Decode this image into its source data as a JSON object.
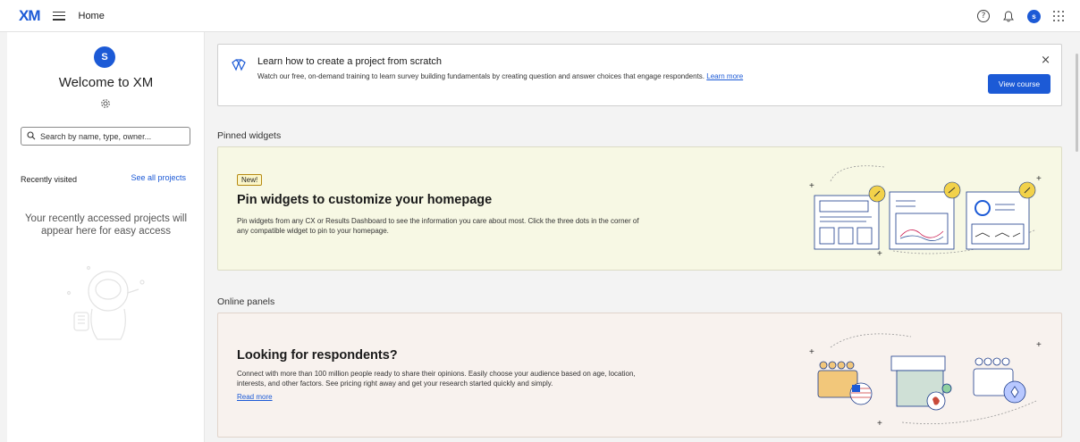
{
  "topbar": {
    "logo": "XM",
    "title": "Home",
    "help_icon": "?",
    "avatar_initial": "s"
  },
  "sidebar": {
    "avatar_initial": "S",
    "welcome": "Welcome to XM",
    "search_placeholder": "Search by name, type, owner...",
    "recently_visited": "Recently visited",
    "see_all": "See all projects",
    "empty_message": "Your recently accessed projects will appear here for easy access"
  },
  "learn": {
    "title": "Learn how to create a project from scratch",
    "description": "Watch our free, on-demand training to learn survey building fundamentals by creating question and answer choices that engage respondents.",
    "link": "Learn more",
    "close": "×",
    "button": "View course"
  },
  "pinned": {
    "section_title": "Pinned widgets",
    "badge": "New!",
    "title": "Pin widgets to customize your homepage",
    "description": "Pin widgets from any CX or Results Dashboard to see the information you care about most. Click the three dots in the corner of any compatible widget to pin to your homepage."
  },
  "online": {
    "section_title": "Online panels",
    "title": "Looking for respondents?",
    "description": "Connect with more than 100 million people ready to share their opinions. Easily choose your audience based on age, location, interests, and other factors. See pricing right away and get your research started quickly and simply.",
    "link": "Read more"
  },
  "colors": {
    "brand": "#1c5ad6",
    "pin_card_bg": "#f7f8e4",
    "online_card_bg": "#f8f2ee",
    "pin_accent": "#f2d24a"
  },
  "icons": [
    "menu-icon",
    "help-icon",
    "bell-icon",
    "apps-grid-icon",
    "gear-icon",
    "search-icon",
    "close-icon",
    "pin-icon",
    "hands-icon"
  ]
}
